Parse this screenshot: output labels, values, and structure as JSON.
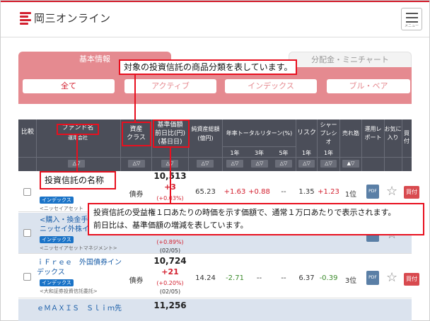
{
  "header": {
    "logo_text": "岡三オンライン",
    "menu_label": "メニュー"
  },
  "tabs": [
    {
      "label": "基本情報"
    },
    {
      "label": "分配金・ミニチャート"
    }
  ],
  "filters": [
    {
      "label": "全て"
    },
    {
      "label": "アクティブ"
    },
    {
      "label": "インデックス"
    },
    {
      "label": "ブル・ベア"
    }
  ],
  "table": {
    "headers": {
      "compare": "比較",
      "fund_name": "ファンド名",
      "company": "運用会社",
      "asset_class_1": "資産",
      "asset_class_2": "クラス",
      "nav_1": "基準価額",
      "nav_2": "前日比(円)",
      "nav_3": "(基日日)",
      "net_assets_1": "純資産総額",
      "net_assets_2": "(億円)",
      "total_return": "年率トータルリターン(%)",
      "tr_1y": "1年",
      "tr_3y": "3年",
      "tr_5y": "5年",
      "risk": "リスク",
      "risk_1y": "1年",
      "sharpe_1": "シャー",
      "sharpe_2": "プレシ",
      "sharpe_3": "オ",
      "sharpe_1y": "1年",
      "ranking": "売れ筋",
      "report_1": "運用レ",
      "report_2": "ポート",
      "favorite_1": "お気に",
      "favorite_2": "入り",
      "buy": "買付",
      "sort_both": "△▽",
      "sort_desc": "▲▽"
    },
    "rows": [
      {
        "name_line1": "",
        "name_line2": "",
        "badge": "インデックス",
        "company": "<ニッセイアセット",
        "asset_class": "債券",
        "price": "10,513",
        "change": "+3",
        "change_pct": "(+0.03%)",
        "net_assets": "65.23",
        "tr_1y": "+1.63",
        "tr_3y": "+0.88",
        "tr_5y": "--",
        "risk": "1.35",
        "sharpe": "+1.23",
        "rank": "1位",
        "buy": "買付"
      },
      {
        "name_line1": "<購入・換金手",
        "name_line2": "ニッセイ外株イ",
        "badge": "インデックス",
        "company": "<ニッセイアセットマネジメント>",
        "change_pct": "(+0.89%)",
        "date": "(02/05)"
      },
      {
        "name_line1": "ｉＦｒｅｅ　外国債券イン",
        "name_line2": "デックス",
        "badge": "インデックス",
        "company": "<大和証券投資信託委託>",
        "asset_class": "債券",
        "price": "10,724",
        "change": "+21",
        "change_pct": "(+0.20%)",
        "date": "(02/05)",
        "net_assets": "14.24",
        "tr_1y": "-2.71",
        "tr_3y": "--",
        "tr_5y": "--",
        "risk": "6.37",
        "sharpe": "-0.39",
        "rank": "3位",
        "buy": "買付"
      },
      {
        "name_line1": "ｅＭＡＸＩＳ　Ｓｌｉｍ先",
        "price": "11,256"
      }
    ]
  },
  "icons": {
    "pdf": "PDF",
    "star": "☆"
  },
  "annotations": {
    "classification": "対象の投資信託の商品分類を表しています。",
    "fund_name": "投資信託の名称",
    "nav_line1": "投資信託の受益権１口あたりの時価を示す価額で、通常１万口あたりで表示されます。",
    "nav_line2": "前日比は、基準価額の増減を表しています。"
  },
  "colors": {
    "brand_red": "#d3202f",
    "tab_pink": "#e58a90",
    "header_dark": "#4b4e59",
    "link_blue": "#1a5ea8",
    "callout_red": "#e8101f"
  }
}
